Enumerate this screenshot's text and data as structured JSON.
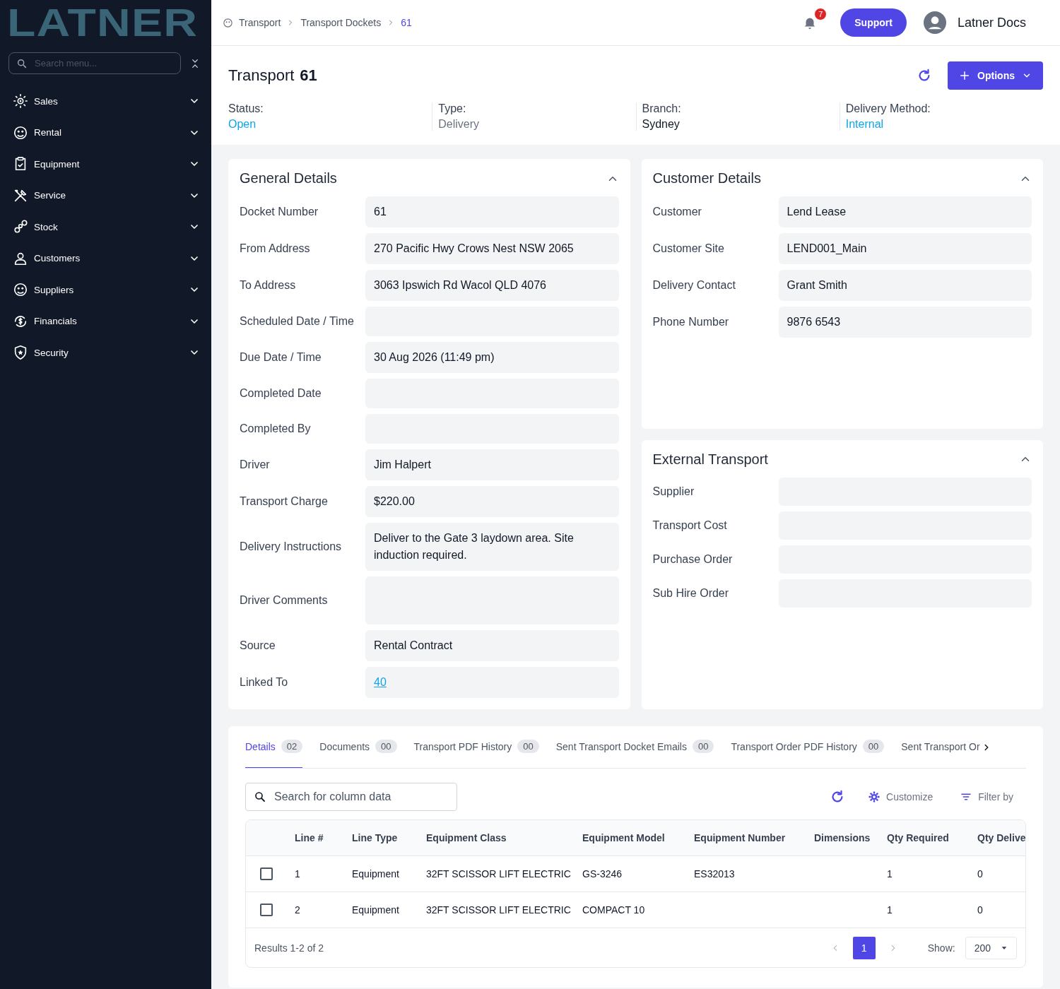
{
  "sidebar": {
    "logo": "LATNER",
    "search": {
      "placeholder": "Search menu..."
    },
    "items": [
      {
        "label": "Sales",
        "expanded": false
      },
      {
        "label": "Rental",
        "expanded": false
      },
      {
        "label": "Equipment",
        "expanded": false
      },
      {
        "label": "Service",
        "expanded": false
      },
      {
        "label": "Stock",
        "expanded": false
      },
      {
        "label": "Customers",
        "expanded": false
      },
      {
        "label": "Suppliers",
        "expanded": false
      },
      {
        "label": "Financials",
        "expanded": false
      },
      {
        "label": "Security",
        "expanded": false
      }
    ]
  },
  "breadcrumbs": [
    "Transport",
    "Transport Dockets",
    "61"
  ],
  "topbar": {
    "notifications": "7",
    "support": "Support",
    "user": "Latner Docs"
  },
  "header": {
    "title": "Transport",
    "number": "61",
    "options": "Options",
    "meta": [
      {
        "label": "Status:",
        "value": "Open",
        "kind": "accent"
      },
      {
        "label": "Type:",
        "value": "Delivery",
        "kind": "muted"
      },
      {
        "label": "Branch:",
        "value": "Sydney",
        "kind": "plain"
      },
      {
        "label": "Delivery Method:",
        "value": "Internal",
        "kind": "accent"
      }
    ]
  },
  "general": {
    "title": "General Details",
    "expanded": true,
    "fields": [
      {
        "label": "Docket Number",
        "value": "61",
        "kind": "text"
      },
      {
        "label": "From Address",
        "value": "270 Pacific Hwy Crows Nest NSW 2065",
        "kind": "text"
      },
      {
        "label": "To Address",
        "value": "3063 Ipswich Rd Wacol QLD 4076",
        "kind": "text"
      },
      {
        "label": "Scheduled Date / Time",
        "kind": "text"
      },
      {
        "label": "Due Date / Time",
        "value": "30 Aug 2026 (11:49 pm)",
        "kind": "text"
      },
      {
        "label": "Completed Date",
        "kind": "text"
      },
      {
        "label": "Completed By",
        "kind": "text"
      },
      {
        "label": "Driver",
        "value": "Jim Halpert",
        "kind": "text"
      },
      {
        "label": "Transport Charge",
        "value": "$220.00",
        "kind": "text"
      },
      {
        "label": "Delivery Instructions",
        "value": "Deliver to the Gate 3 laydown area. Site induction required.",
        "kind": "area"
      },
      {
        "label": "Driver Comments",
        "kind": "area"
      },
      {
        "label": "Source",
        "value": "Rental Contract",
        "kind": "text"
      },
      {
        "label": "Linked To",
        "value": "40",
        "kind": "link"
      }
    ]
  },
  "customer": {
    "title": "Customer Details",
    "expanded": true,
    "fields": [
      {
        "label": "Customer",
        "value": "Lend Lease"
      },
      {
        "label": "Customer Site",
        "value": "LEND001_Main"
      },
      {
        "label": "Delivery Contact",
        "value": "Grant Smith"
      },
      {
        "label": "Phone Number",
        "value": "9876 6543"
      }
    ]
  },
  "external": {
    "title": "External Transport",
    "expanded": true,
    "fields": [
      {
        "label": "Supplier"
      },
      {
        "label": "Transport Cost"
      },
      {
        "label": "Purchase Order"
      },
      {
        "label": "Sub Hire Order"
      }
    ]
  },
  "tabs": [
    {
      "label": "Details",
      "count": "02",
      "selected": true
    },
    {
      "label": "Documents",
      "count": "00",
      "selected": false
    },
    {
      "label": "Transport PDF History",
      "count": "00",
      "selected": false
    },
    {
      "label": "Sent Transport Docket Emails",
      "count": "00",
      "selected": false
    },
    {
      "label": "Transport Order PDF History",
      "count": "00",
      "selected": false
    },
    {
      "label": "Sent Transport Or",
      "selected": false
    }
  ],
  "toolbar": {
    "search": {
      "placeholder": "Search for column data"
    },
    "customize": "Customize",
    "filter": "Filter by"
  },
  "table": {
    "columns": [
      "Line #",
      "Line Type",
      "Equipment Class",
      "Equipment Model",
      "Equipment Number",
      "Dimensions",
      "Qty Required",
      "Qty Delive"
    ],
    "rows": [
      {
        "checked": false,
        "cells": [
          "1",
          "Equipment",
          "32FT SCISSOR LIFT ELECTRIC",
          "GS-3246",
          "ES32013",
          "",
          "1",
          "0"
        ]
      },
      {
        "checked": false,
        "cells": [
          "2",
          "Equipment",
          "32FT SCISSOR LIFT ELECTRIC",
          "COMPACT 10",
          "",
          "",
          "1",
          "0"
        ]
      }
    ]
  },
  "footer": {
    "results": "Results 1-2 of 2",
    "pages": [
      {
        "label": "1",
        "selected": true
      }
    ],
    "show_label": "Show:",
    "show_value": "200"
  }
}
